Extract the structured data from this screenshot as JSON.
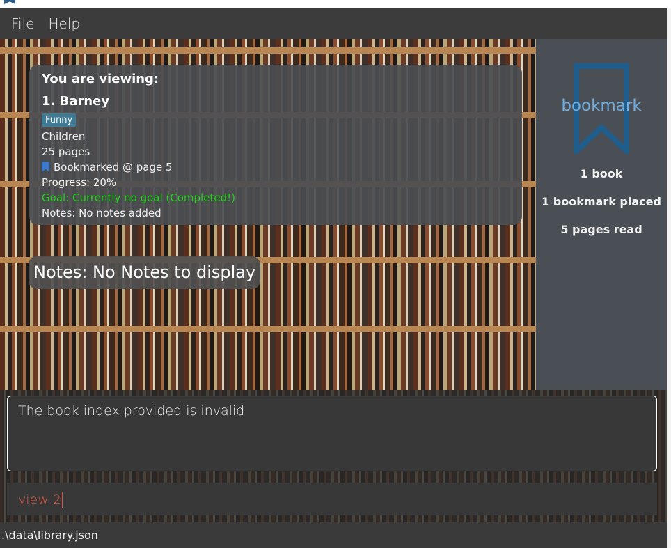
{
  "menu": {
    "file": "File",
    "help": "Help"
  },
  "book_card": {
    "viewing_label": "You are viewing:",
    "title": "1.  Barney",
    "tag": "Funny",
    "genre": "Children",
    "pages": "25 pages",
    "bookmark": "Bookmarked @ page 5",
    "progress": "Progress: 20%",
    "goal": "Goal: Currently no goal (Completed!)",
    "notes": "Notes: No notes added"
  },
  "notes_display": "Notes: No Notes to display",
  "side_panel": {
    "logo_text": "bookmark",
    "books_count": "1 book",
    "bookmarks_placed": "1 bookmark placed",
    "pages_read": "5 pages read"
  },
  "result_display": "The book index provided is invalid",
  "command_box": {
    "value": "view 2"
  },
  "status_bar": {
    "path": ".\\data\\library.json"
  },
  "colors": {
    "accent_blue": "#6faee0",
    "goal_green": "#22d11a",
    "command_text": "#d9533d",
    "tag_bg": "#3f7b95"
  }
}
